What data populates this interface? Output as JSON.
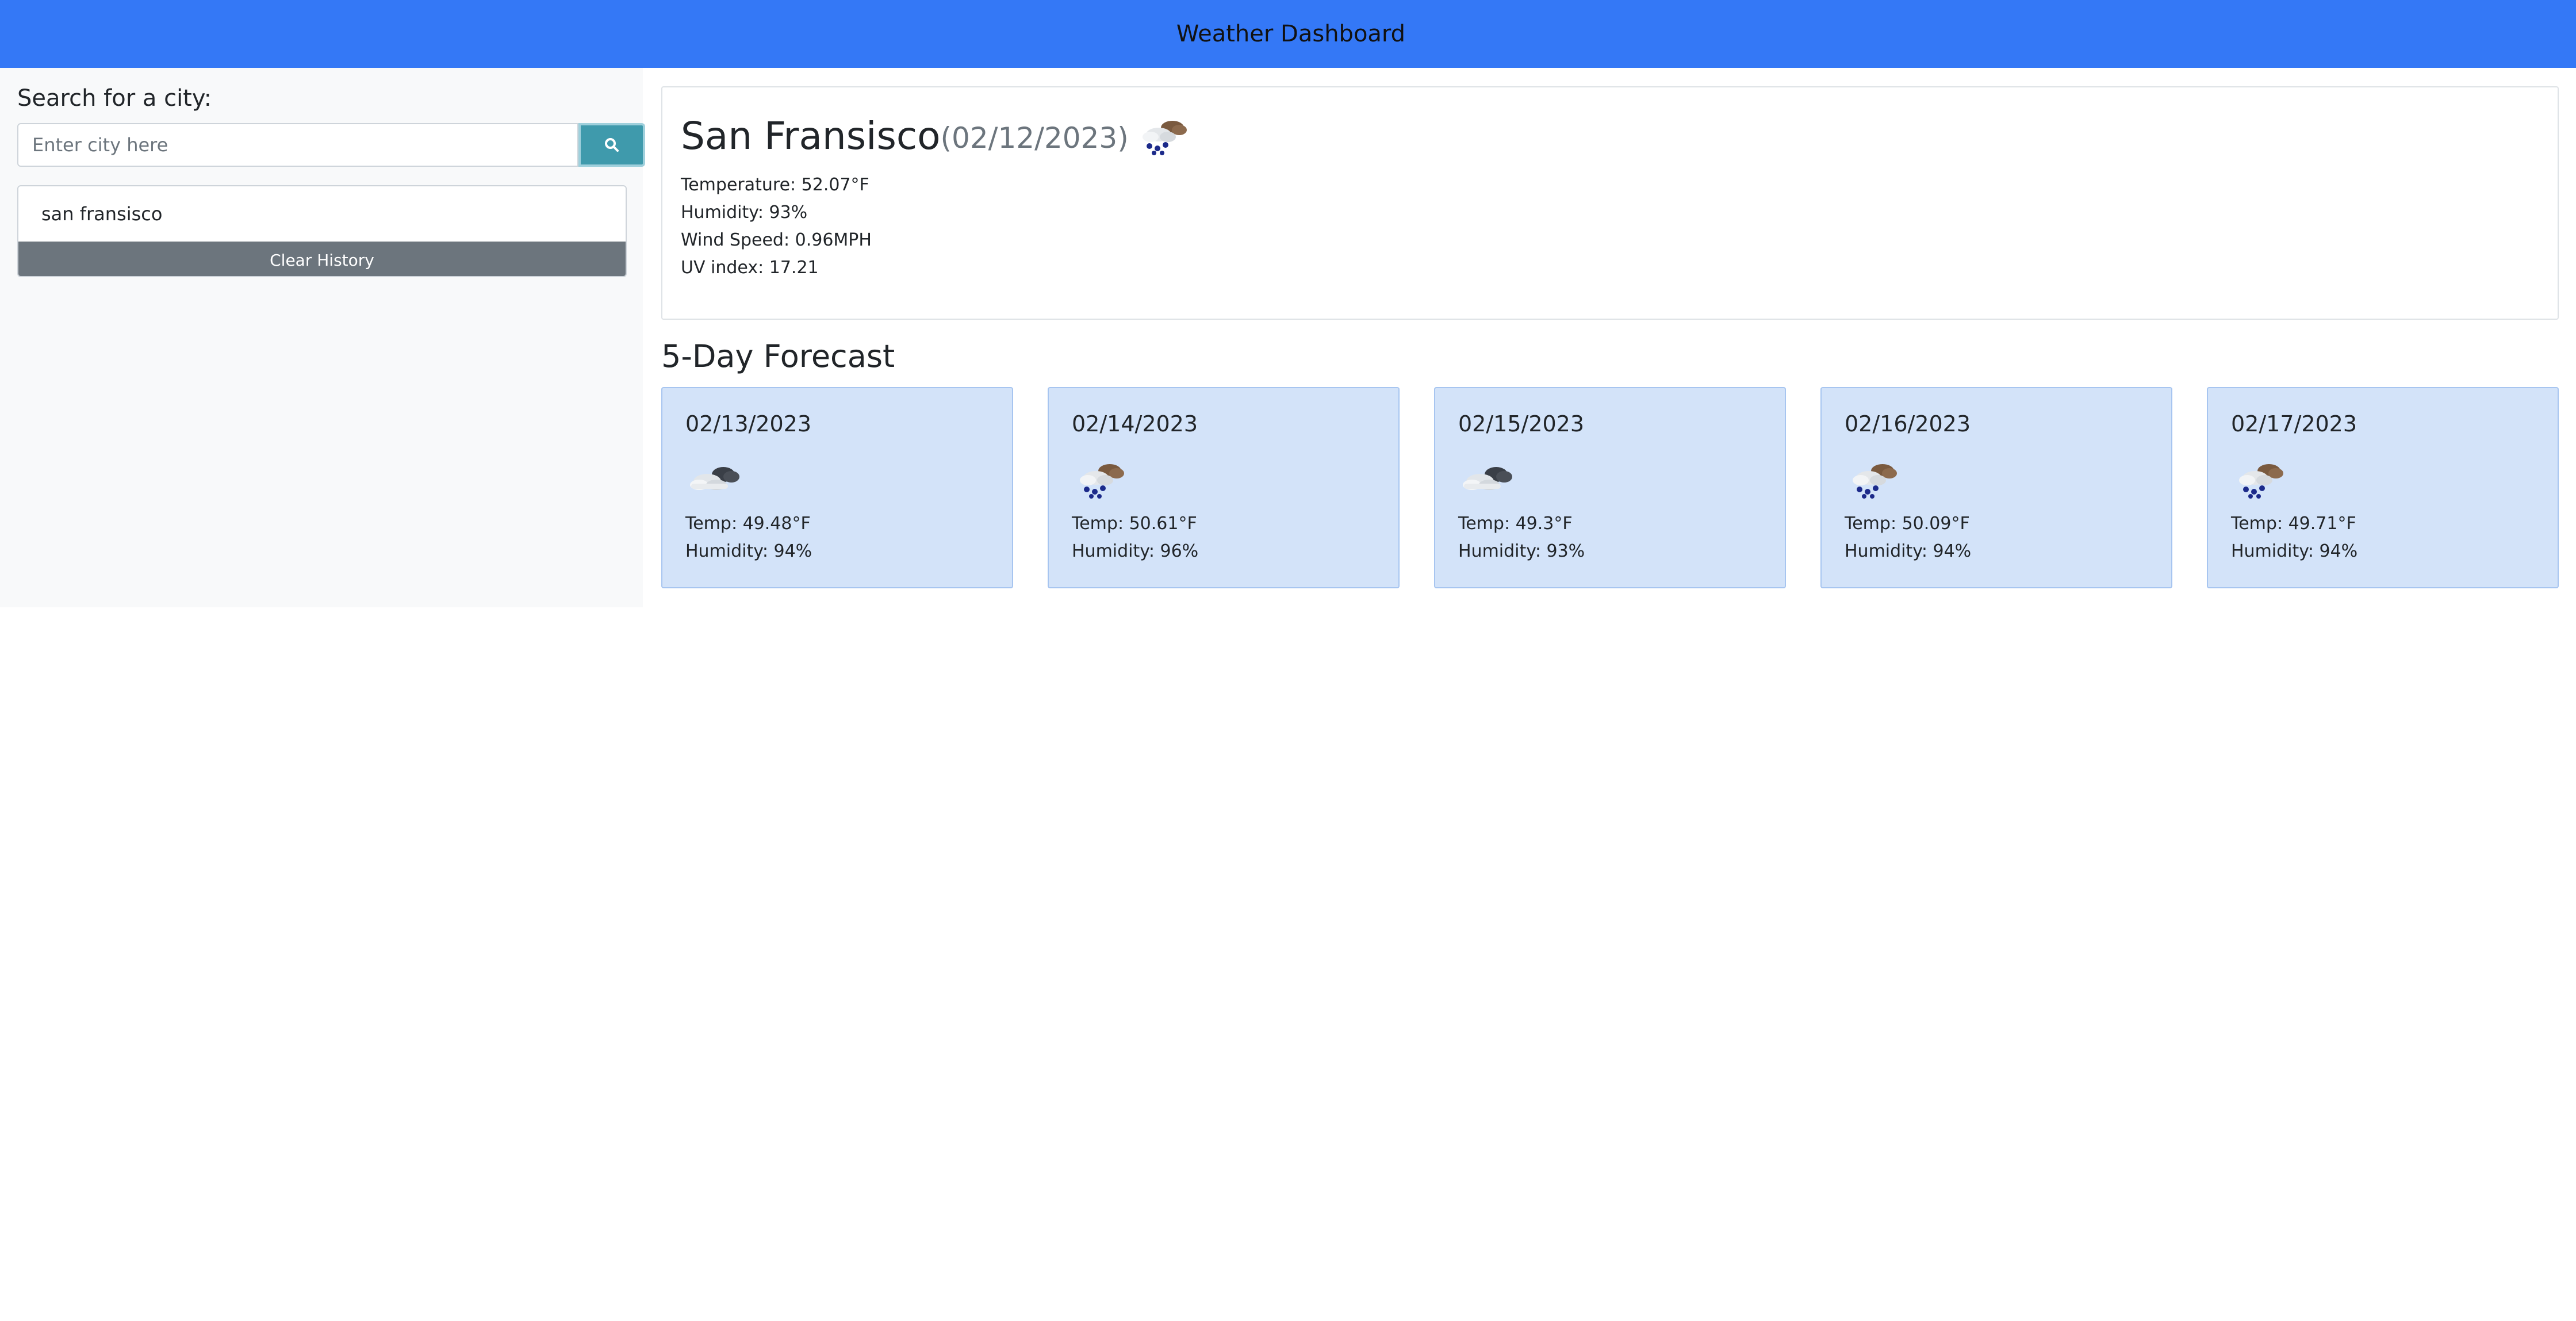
{
  "header": {
    "title": "Weather Dashboard"
  },
  "sidebar": {
    "search_label": "Search for a city:",
    "search_placeholder": "Enter city here",
    "search_value": "",
    "search_icon": "search-icon",
    "history": [
      "san fransisco"
    ],
    "clear_label": "Clear History"
  },
  "current": {
    "city": "San Fransisco",
    "date": "(02/12/2023)",
    "icon": "rain-cloud-icon",
    "temperature": "Temperature: 52.07°F",
    "humidity": "Humidity: 93%",
    "wind": "Wind Speed: 0.96MPH",
    "uv": "UV index: 17.21"
  },
  "forecast": {
    "heading": "5-Day Forecast",
    "days": [
      {
        "date": "02/13/2023",
        "icon": "cloud-icon",
        "temp": "Temp: 49.48°F",
        "humidity": "Humidity: 94%"
      },
      {
        "date": "02/14/2023",
        "icon": "rain-cloud-icon",
        "temp": "Temp: 50.61°F",
        "humidity": "Humidity: 96%"
      },
      {
        "date": "02/15/2023",
        "icon": "cloud-icon",
        "temp": "Temp: 49.3°F",
        "humidity": "Humidity: 93%"
      },
      {
        "date": "02/16/2023",
        "icon": "rain-cloud-icon",
        "temp": "Temp: 50.09°F",
        "humidity": "Humidity: 94%"
      },
      {
        "date": "02/17/2023",
        "icon": "rain-cloud-icon",
        "temp": "Temp: 49.71°F",
        "humidity": "Humidity: 94%"
      }
    ]
  },
  "colors": {
    "header_bg": "#3478f6",
    "sidebar_bg": "#f8f9fa",
    "search_button_bg": "#3f9aac",
    "clear_button_bg": "#6c757d",
    "forecast_card_bg": "#d3e3f9"
  }
}
